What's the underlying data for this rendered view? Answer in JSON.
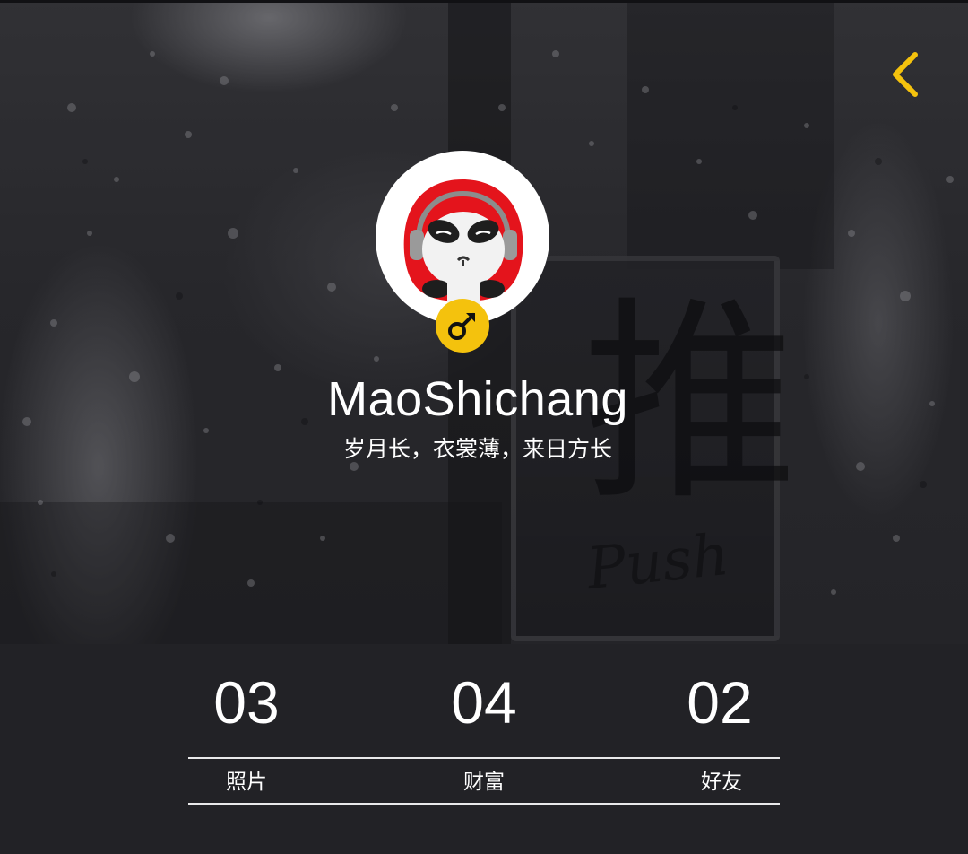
{
  "header": {
    "back_icon": "chevron-left-icon",
    "accent_color": "#f4c20d"
  },
  "profile": {
    "avatar_icon": "panda-avatar",
    "gender_icon": "male-symbol-icon",
    "username": "MaoShichang",
    "bio": "岁月长，衣裳薄，来日方长"
  },
  "stats": [
    {
      "value": "03",
      "label": "照片"
    },
    {
      "value": "04",
      "label": "财富"
    },
    {
      "value": "02",
      "label": "好友"
    }
  ],
  "background_photo": {
    "sign_glyph": "推",
    "sign_word": "Push"
  }
}
